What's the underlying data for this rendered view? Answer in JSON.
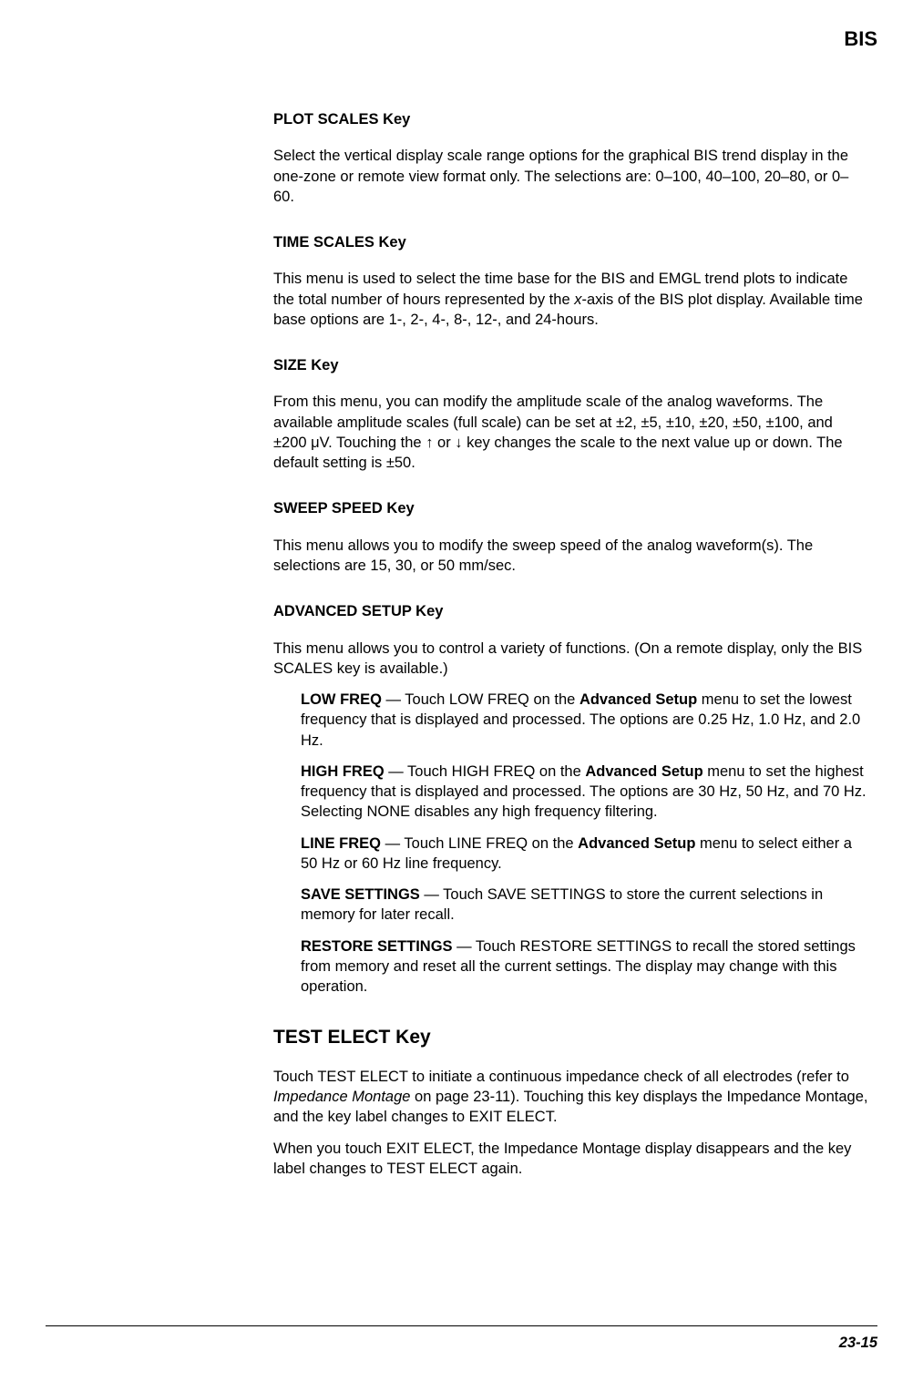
{
  "header": {
    "right": "BIS"
  },
  "s1": {
    "title": "PLOT SCALES Key",
    "body": "Select the vertical display scale range options for the graphical BIS trend display in the one-zone or remote view format only. The selections are: 0–100, 40–100, 20–80, or 0–60."
  },
  "s2": {
    "title": "TIME SCALES Key",
    "body_a": "This menu is used to select the time base for the BIS and EMGL trend plots to indicate the total number of hours represented by the ",
    "body_x": "x",
    "body_b": "-axis of the BIS plot display. Available time base options are 1-, 2-, 4-, 8-, 12-, and 24-hours."
  },
  "s3": {
    "title": "SIZE Key",
    "body": "From this menu, you can modify the amplitude scale of the analog waveforms. The available amplitude scales (full scale) can be set at  ±2, ±5, ±10, ±20, ±50, ±100, and ±200 μV. Touching the ↑ or ↓ key changes the scale to the next value up or down. The default setting is ±50."
  },
  "s4": {
    "title": "SWEEP SPEED Key",
    "body": "This menu allows you to modify the sweep speed of the analog waveform(s). The selections are 15, 30, or 50 mm/sec."
  },
  "s5": {
    "title": "ADVANCED SETUP Key",
    "intro": "This menu allows you to control a variety of functions. (On a remote display, only the BIS SCALES key is available.)",
    "items": {
      "lowfreq": {
        "label": "LOW FREQ",
        "a": " — Touch LOW FREQ on the ",
        "menu": "Advanced Setup",
        "b": " menu to set the lowest frequency that is displayed and processed. The options are 0.25 Hz, 1.0 Hz, and 2.0 Hz."
      },
      "highfreq": {
        "label": "HIGH FREQ",
        "a": " — Touch HIGH FREQ on the ",
        "menu": "Advanced Setup",
        "b": " menu to set the highest frequency that is displayed and processed. The options are 30 Hz, 50 Hz, and 70 Hz. Selecting NONE disables any high frequency filtering."
      },
      "linefreq": {
        "label": "LINE FREQ",
        "a": " — Touch LINE FREQ on the ",
        "menu": "Advanced Setup",
        "b": " menu to select either a 50 Hz or 60 Hz line frequency."
      },
      "save": {
        "label": "SAVE SETTINGS",
        "rest": " — Touch SAVE SETTINGS to store the current selections in memory for later recall."
      },
      "restore": {
        "label": "RESTORE SETTINGS",
        "rest": " — Touch RESTORE SETTINGS to recall the stored settings from memory and reset all the current settings. The display may change with this operation."
      }
    }
  },
  "s6": {
    "title": "TEST ELECT Key",
    "p1a": "Touch TEST ELECT to initiate a continuous impedance check of all electrodes (refer to ",
    "p1i": "Impedance Montage",
    "p1b": " on page 23-11). Touching this key displays the Impedance Montage, and the key label changes to EXIT ELECT.",
    "p2": "When you touch EXIT ELECT, the Impedance Montage display disappears and the key label changes to TEST ELECT again."
  },
  "footer": {
    "page": "23-15"
  }
}
